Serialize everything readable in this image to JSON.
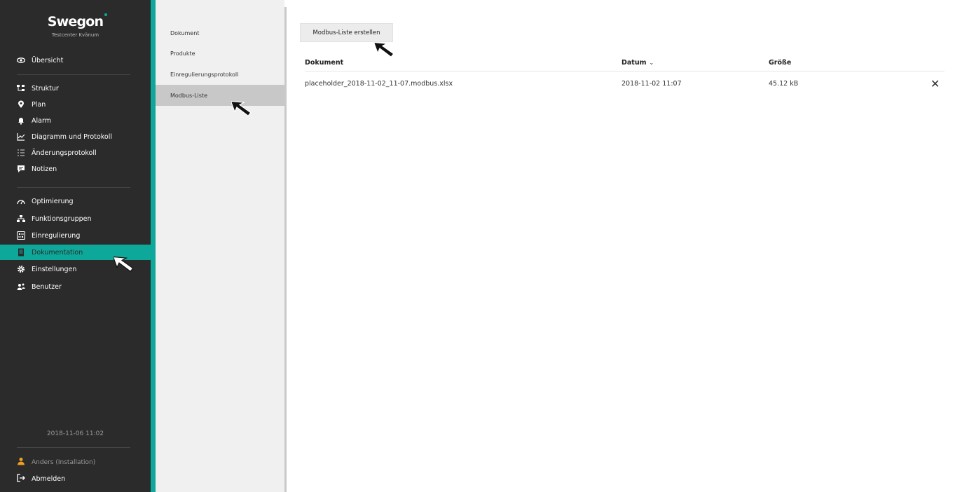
{
  "brand": {
    "logo": "Swegon",
    "subtitle": "Testcenter Kvänum"
  },
  "sidebar": {
    "items": [
      {
        "label": "Übersicht",
        "icon": "eye-icon"
      },
      {
        "label": "Struktur",
        "icon": "structure-icon"
      },
      {
        "label": "Plan",
        "icon": "map-pin-icon"
      },
      {
        "label": "Alarm",
        "icon": "bell-icon"
      },
      {
        "label": "Diagramm und Protokoll",
        "icon": "chart-line-icon"
      },
      {
        "label": "Änderungsprotokoll",
        "icon": "list-icon"
      },
      {
        "label": "Notizen",
        "icon": "chat-icon"
      },
      {
        "label": "Optimierung",
        "icon": "gauge-icon"
      },
      {
        "label": "Funktionsgruppen",
        "icon": "hierarchy-icon"
      },
      {
        "label": "Einregulierung",
        "icon": "balance-icon"
      },
      {
        "label": "Dokumentation",
        "icon": "document-icon"
      },
      {
        "label": "Einstellungen",
        "icon": "gear-icon"
      },
      {
        "label": "Benutzer",
        "icon": "users-icon"
      }
    ],
    "active": "Dokumentation",
    "footer_date": "2018-11-06 11:02",
    "user": "Anders (Installation)",
    "logout": "Abmelden"
  },
  "subnav": {
    "items": [
      "Dokument",
      "Produkte",
      "Einregulierungsprotokoll",
      "Modbus-Liste"
    ],
    "active": "Modbus-Liste"
  },
  "main": {
    "create_button": "Modbus-Liste erstellen",
    "columns": {
      "document": "Dokument",
      "date": "Datum",
      "size": "Größe"
    },
    "rows": [
      {
        "document": "placeholder_2018-11-02_11-07.modbus.xlsx",
        "date": "2018-11-02 11:07",
        "size": "45.12 kB"
      }
    ]
  },
  "colors": {
    "accent": "#0ea89a",
    "sidebar_bg": "#2b2b2b",
    "subnav_bg": "#f0f0f0",
    "subnav_active": "#c8c8c8"
  }
}
